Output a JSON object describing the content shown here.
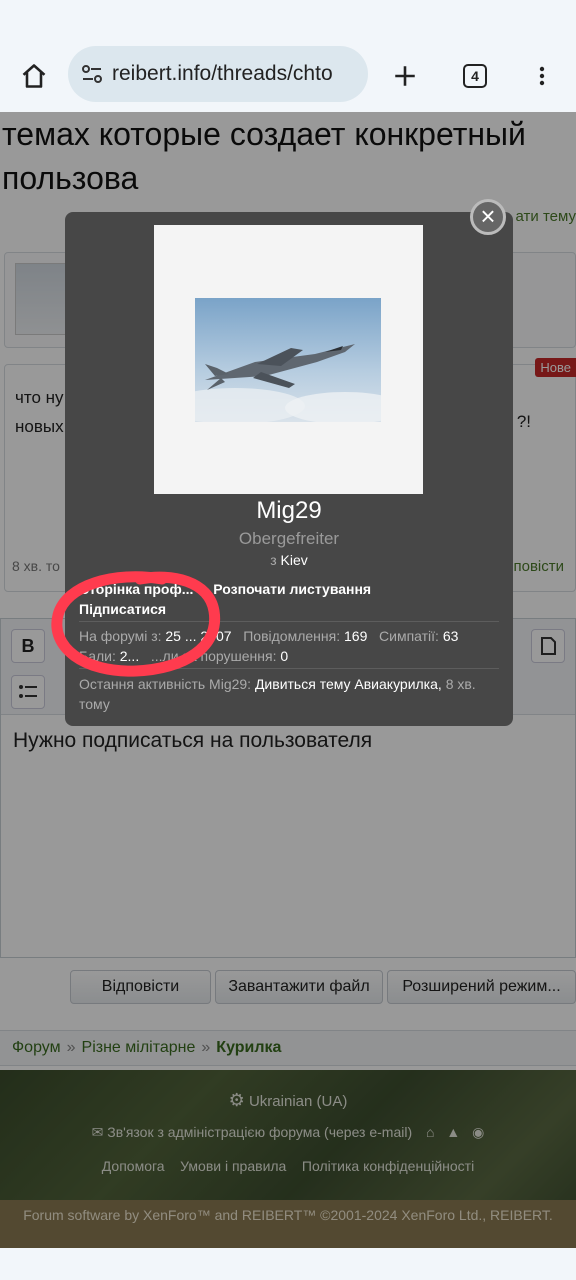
{
  "browser": {
    "url": "reibert.info/threads/chto",
    "tab_count": "4"
  },
  "page": {
    "thread_title": "темах которые создает конкретный пользова",
    "reply_to_thread_partial": "ати тему",
    "post_preview_lines": [
      "что ну",
      "новых"
    ],
    "post_preview_tail": "?!",
    "new_badge": "Нове",
    "post_time": "8 хв. то",
    "post_reply_partial": "повісти",
    "editor_text": "Нужно подписаться на пользователя",
    "buttons": {
      "reply": "Відповісти",
      "upload": "Завантажити файл",
      "advanced": "Розширений режим..."
    },
    "breadcrumb": {
      "forum": "Форум",
      "section": "Різне мілітарне",
      "current": "Курилка"
    },
    "footer": {
      "language": "Ukrainian (UA)",
      "contact": "Зв'язок з адміністрацією форума (через e-mail)",
      "help": "Допомога",
      "terms": "Умови і правила",
      "privacy": "Політика конфіденційності",
      "copyright": "Forum software by XenForo™ and REIBERT™ ©2001-2024 XenForo Ltd., REIBERT."
    }
  },
  "member_card": {
    "username": "Mig29",
    "rank": "Obergefreiter",
    "location_prefix": "з",
    "location": "Kiev",
    "profile_link": "Сторінка проф...",
    "start_conversation": "Розпочати листування",
    "subscribe": "Підписатися",
    "stats": {
      "joined_label": "На форумі з:",
      "joined_value": "25 ... 2007",
      "messages_label": "Повідомлення:",
      "messages_value": "169",
      "likes_label": "Симпатії:",
      "likes_value": "63",
      "points_label": "Бали:",
      "points_value": "2...",
      "warnings_label": "...ли за порушення:",
      "warnings_value": "0"
    },
    "activity_label": "Остання активність Mig29:",
    "activity_value": "Дивиться тему Авиакурилка,",
    "activity_time": "8 хв. тому"
  },
  "annotation": {
    "color": "#ff3b4e"
  }
}
